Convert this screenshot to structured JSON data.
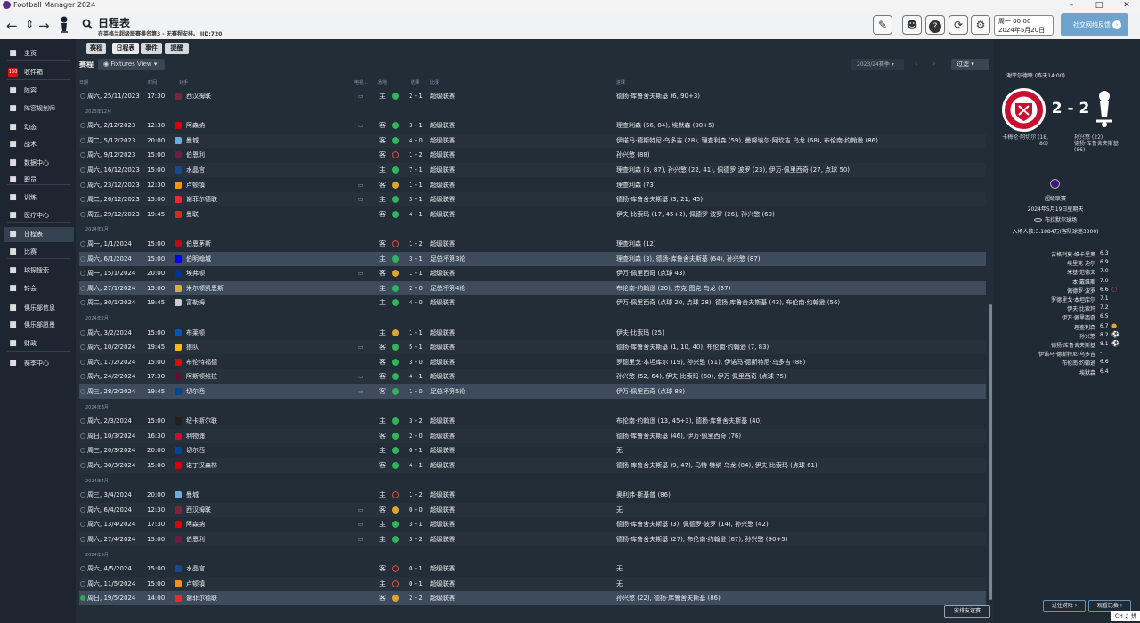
{
  "window": {
    "title": "Football Manager 2024"
  },
  "header": {
    "title": "日程表",
    "subtitle": "在英格兰超级联赛排名第3 - 无赛程安排。 IID:720",
    "date_line1": "周一 00:00",
    "date_line2": "2024年5月20日",
    "social_label": "社交网络反馈"
  },
  "tabs": [
    "赛程",
    "日程表",
    "事件",
    "提醒"
  ],
  "main": {
    "section_label": "赛程",
    "view_label": "Fixtures View",
    "season": "2023/24赛季",
    "filter_label": "过滤",
    "friendly_label": "安排友谊赛"
  },
  "columns": {
    "date": "日期",
    "time": "时间",
    "opponent": "对手",
    "tv": "电视...",
    "venue": "场地",
    "result": "结果",
    "competition": "比赛",
    "scorers": "进球"
  },
  "sidebar": [
    {
      "label": "主页",
      "icon": "home-icon"
    },
    {
      "label": "收件箱",
      "icon": "inbox-icon",
      "badge": "150"
    },
    {
      "label": "阵容",
      "icon": "shirt-icon"
    },
    {
      "label": "阵容规划师",
      "icon": "planner-icon"
    },
    {
      "label": "动态",
      "icon": "dynamics-icon"
    },
    {
      "label": "战术",
      "icon": "tactics-icon"
    },
    {
      "label": "数据中心",
      "icon": "data-icon"
    },
    {
      "label": "职员",
      "icon": "staff-icon"
    },
    {
      "label": "训练",
      "icon": "training-icon"
    },
    {
      "label": "医疗中心",
      "icon": "medical-icon"
    },
    {
      "label": "日程表",
      "icon": "calendar-icon"
    },
    {
      "label": "比赛",
      "icon": "trophy-icon"
    },
    {
      "label": "球探搜索",
      "icon": "scout-icon"
    },
    {
      "label": "转会",
      "icon": "transfer-icon"
    },
    {
      "label": "俱乐部信息",
      "icon": "club-icon"
    },
    {
      "label": "俱乐部愿景",
      "icon": "vision-icon"
    },
    {
      "label": "财政",
      "icon": "finance-icon"
    },
    {
      "label": "赛季中心",
      "icon": "season-icon"
    }
  ],
  "fixtures": [
    {
      "date": "周六, 25/11/2023",
      "time": "17:30",
      "opp": "西汉姆联",
      "crest": "#7a263a",
      "tv": true,
      "venue": "主",
      "res": "W",
      "score": "2 - 1",
      "comp": "超级联赛",
      "scorers": "德扬·库鲁舍夫斯基 (6, 90+3)"
    },
    {
      "month": "2023年12月"
    },
    {
      "date": "周六, 2/12/2023",
      "time": "12:30",
      "opp": "阿森纳",
      "crest": "#db0007",
      "tv": true,
      "venue": "客",
      "res": "W",
      "score": "3 - 1",
      "comp": "超级联赛",
      "scorers": "理查利森 (56, 84), 埃默森 (90+5)"
    },
    {
      "date": "周二, 5/12/2023",
      "time": "20:00",
      "opp": "曼城",
      "crest": "#6cabdd",
      "tv": false,
      "venue": "客",
      "res": "W",
      "score": "4 - 0",
      "comp": "超级联赛",
      "scorers": "伊诺马·德斯特尼·乌多吉 (28), 理查利森 (59), 曼努埃尔·阿坎吉 乌龙 (68), 布伦南·约翰逊 (86)"
    },
    {
      "date": "周六, 9/12/2023",
      "time": "15:00",
      "opp": "伯恩利",
      "crest": "#6c1d45",
      "tv": false,
      "venue": "客",
      "res": "L",
      "score": "1 - 2",
      "comp": "超级联赛",
      "scorers": "孙兴慜 (88)"
    },
    {
      "date": "周六, 16/12/2023",
      "time": "15:00",
      "opp": "水晶宫",
      "crest": "#1b458f",
      "tv": false,
      "venue": "主",
      "res": "W",
      "score": "7 - 1",
      "comp": "超级联赛",
      "scorers": "理查利森 (3, 87), 孙兴慜 (22, 41), 佩德罗·波罗 (23), 伊万·佩里西奇 (27, 点球 50)"
    },
    {
      "date": "周六, 23/12/2023",
      "time": "12:30",
      "opp": "卢顿镇",
      "crest": "#f78f1e",
      "tv": true,
      "venue": "客",
      "res": "D",
      "score": "1 - 1",
      "comp": "超级联赛",
      "scorers": "理查利森 (73)"
    },
    {
      "date": "周二, 26/12/2023",
      "time": "15:00",
      "opp": "谢菲尔德联",
      "crest": "#ee2737",
      "tv": true,
      "venue": "主",
      "res": "W",
      "score": "3 - 1",
      "comp": "超级联赛",
      "scorers": "德扬·库鲁舍夫斯基 (3, 21, 45)"
    },
    {
      "date": "周五, 29/12/2023",
      "time": "19:45",
      "opp": "曼联",
      "crest": "#da291c",
      "tv": false,
      "venue": "客",
      "res": "W",
      "score": "4 - 1",
      "comp": "超级联赛",
      "scorers": "伊夫·比索玛 (17, 45+2), 佩德罗·波罗 (26), 孙兴慜 (60)"
    },
    {
      "month": "2024年1月"
    },
    {
      "date": "周一, 1/1/2024",
      "time": "15:00",
      "opp": "伯恩茅斯",
      "crest": "#b50e12",
      "tv": false,
      "venue": "客",
      "res": "L",
      "score": "1 - 2",
      "comp": "超级联赛",
      "scorers": "理查利森 (12)"
    },
    {
      "date": "周六, 6/1/2024",
      "time": "15:00",
      "opp": "伯明翰城",
      "crest": "#0000ff",
      "tv": false,
      "venue": "主",
      "res": "W",
      "score": "3 - 1",
      "comp": "足总杯第3轮",
      "scorers": "理查利森 (3), 德扬·库鲁舍夫斯基 (64), 孙兴慜 (87)",
      "hl": true
    },
    {
      "date": "周一, 15/1/2024",
      "time": "20:00",
      "opp": "埃弗顿",
      "crest": "#003399",
      "tv": true,
      "venue": "客",
      "res": "D",
      "score": "1 - 1",
      "comp": "超级联赛",
      "scorers": "伊万·佩里西奇 (点球 43)"
    },
    {
      "date": "周六, 27/1/2024",
      "time": "15:00",
      "opp": "米尔顿凯恩斯",
      "crest": "#d4af37",
      "tv": false,
      "venue": "主",
      "res": "W",
      "score": "2 - 0",
      "comp": "足总杯第4轮",
      "scorers": "布伦南·约翰逊 (20), 杰克·图克 乌龙 (37)",
      "hl": true
    },
    {
      "date": "周二, 30/1/2024",
      "time": "19:45",
      "opp": "富勒姆",
      "crest": "#cccccc",
      "tv": false,
      "venue": "主",
      "res": "W",
      "score": "4 - 0",
      "comp": "超级联赛",
      "scorers": "伊万·佩里西奇 (点球 20, 点球 28), 德扬·库鲁舍夫斯基 (43), 布伦南·约翰逊 (56)"
    },
    {
      "month": "2024年2月"
    },
    {
      "date": "周六, 3/2/2024",
      "time": "15:00",
      "opp": "布莱顿",
      "crest": "#0057b8",
      "tv": false,
      "venue": "主",
      "res": "D",
      "score": "1 - 1",
      "comp": "超级联赛",
      "scorers": "伊夫·比索玛 (25)"
    },
    {
      "date": "周六, 10/2/2024",
      "time": "19:45",
      "opp": "狼队",
      "crest": "#fdb913",
      "tv": true,
      "venue": "客",
      "res": "W",
      "score": "5 - 1",
      "comp": "超级联赛",
      "scorers": "德扬·库鲁舍夫斯基 (1, 10, 40), 布伦南·约翰逊 (7, 83)"
    },
    {
      "date": "周六, 17/2/2024",
      "time": "15:00",
      "opp": "布伦特福德",
      "crest": "#e30613",
      "tv": false,
      "venue": "客",
      "res": "W",
      "score": "3 - 0",
      "comp": "超级联赛",
      "scorers": "罗德里戈·本坦库尔 (19), 孙兴慜 (51), 伊诺马·德斯特尼·乌多吉 (88)"
    },
    {
      "date": "周六, 24/2/2024",
      "time": "17:30",
      "opp": "阿斯顿维拉",
      "crest": "#670e36",
      "tv": true,
      "venue": "客",
      "res": "W",
      "score": "4 - 1",
      "comp": "超级联赛",
      "scorers": "孙兴慜 (52, 64), 伊夫·比索玛 (60), 伊万·佩里西奇 (点球 75)"
    },
    {
      "date": "周三, 28/2/2024",
      "time": "19:45",
      "opp": "切尔西",
      "crest": "#034694",
      "tv": true,
      "venue": "客",
      "res": "W",
      "score": "1 - 0",
      "comp": "足总杯第5轮",
      "scorers": "伊万·佩里西奇 (点球 88)",
      "hl": true
    },
    {
      "month": "2024年3月"
    },
    {
      "date": "周六, 2/3/2024",
      "time": "15:00",
      "opp": "纽卡斯尔联",
      "crest": "#241f20",
      "tv": false,
      "venue": "主",
      "res": "W",
      "score": "3 - 2",
      "comp": "超级联赛",
      "scorers": "布伦南·约翰逊 (13, 45+3), 德扬·库鲁舍夫斯基 (40)"
    },
    {
      "date": "周日, 10/3/2024",
      "time": "16:30",
      "opp": "利物浦",
      "crest": "#c8102e",
      "tv": false,
      "venue": "客",
      "res": "W",
      "score": "2 - 0",
      "comp": "超级联赛",
      "scorers": "德扬·库鲁舍夫斯基 (46), 伊万·佩里西奇 (76)"
    },
    {
      "date": "周三, 20/3/2024",
      "time": "20:00",
      "opp": "切尔西",
      "crest": "#034694",
      "tv": false,
      "venue": "主",
      "res": "W",
      "score": "0 - 1",
      "comp": "超级联赛",
      "scorers": "无"
    },
    {
      "date": "周六, 30/3/2024",
      "time": "15:00",
      "opp": "诺丁汉森林",
      "crest": "#dd0000",
      "tv": false,
      "venue": "客",
      "res": "W",
      "score": "4 - 1",
      "comp": "超级联赛",
      "scorers": "德扬·库鲁舍夫斯基 (9, 47), 马特·特纳 乌龙 (84), 伊夫·比索玛 (点球 61)"
    },
    {
      "month": "2024年4月"
    },
    {
      "date": "周三, 3/4/2024",
      "time": "20:00",
      "opp": "曼城",
      "crest": "#6cabdd",
      "tv": false,
      "venue": "主",
      "res": "L",
      "score": "1 - 2",
      "comp": "超级联赛",
      "scorers": "奥利弗·斯基普 (86)"
    },
    {
      "date": "周六, 6/4/2024",
      "time": "12:30",
      "opp": "西汉姆联",
      "crest": "#7a263a",
      "tv": true,
      "venue": "客",
      "res": "D",
      "score": "0 - 0",
      "comp": "超级联赛",
      "scorers": "无"
    },
    {
      "date": "周六, 13/4/2024",
      "time": "17:30",
      "opp": "阿森纳",
      "crest": "#db0007",
      "tv": true,
      "venue": "主",
      "res": "W",
      "score": "3 - 1",
      "comp": "超级联赛",
      "scorers": "德扬·库鲁舍夫斯基 (3), 佩德罗·波罗 (14), 孙兴慜 (42)"
    },
    {
      "date": "周六, 27/4/2024",
      "time": "15:00",
      "opp": "伯恩利",
      "crest": "#6c1d45",
      "tv": true,
      "venue": "主",
      "res": "W",
      "score": "3 - 2",
      "comp": "超级联赛",
      "scorers": "德扬·库鲁舍夫斯基 (27), 布伦南·约翰逊 (67), 孙兴慜 (90+5)"
    },
    {
      "month": "2024年5月"
    },
    {
      "date": "周六, 4/5/2024",
      "time": "15:00",
      "opp": "水晶宫",
      "crest": "#1b458f",
      "tv": false,
      "venue": "客",
      "res": "L",
      "score": "0 - 1",
      "comp": "超级联赛",
      "scorers": "无"
    },
    {
      "date": "周六, 11/5/2024",
      "time": "15:00",
      "opp": "卢顿镇",
      "crest": "#f78f1e",
      "tv": false,
      "venue": "主",
      "res": "L",
      "score": "0 - 1",
      "comp": "超级联赛",
      "scorers": "无"
    },
    {
      "date": "周日, 19/5/2024",
      "time": "14:00",
      "opp": "谢菲尔德联",
      "crest": "#ee2737",
      "tv": false,
      "venue": "客",
      "res": "D",
      "score": "2 - 2",
      "comp": "超级联赛",
      "scorers": "孙兴慜 (22), 德扬·库鲁舍夫斯基 (86)",
      "hl": true,
      "last": true
    }
  ],
  "match": {
    "header": "谢菲尔德联 (昨天14:00)",
    "score": "2 - 2",
    "home_scorers": [
      "卡梅伦·阿切尔 (18,",
      "80)"
    ],
    "away_scorers": [
      "孙兴慜 (22)",
      "德扬·库鲁舍夫斯基",
      "(86)"
    ],
    "competition": "超级联赛",
    "date": "2024年5月19日星期天",
    "stadium": "布拉默尔球场",
    "attendance": "入场人数:3.1884万(客队球迷3000)",
    "ratings": [
      {
        "name": "古格列莫·维卡里奥",
        "rating": "6.3"
      },
      {
        "name": "埃里克·迪尔",
        "rating": "6.9"
      },
      {
        "name": "米基·范德文",
        "rating": "7.0"
      },
      {
        "name": "本·戴维斯",
        "rating": "7.0"
      },
      {
        "name": "佩德罗·波罗",
        "rating": "6.6",
        "icon": "○",
        "color": "#e24a3a"
      },
      {
        "name": "罗德里戈·本坦库尔",
        "rating": "7.1"
      },
      {
        "name": "伊夫·比索玛",
        "rating": "7.2"
      },
      {
        "name": "伊万·佩里西奇",
        "rating": "6.5"
      },
      {
        "name": "理查利森",
        "rating": "6.7",
        "icon": "●",
        "color": "#e0a52b"
      },
      {
        "name": "孙兴慜",
        "rating": "8.2",
        "icon": "⚽",
        "color": "#ffffff"
      },
      {
        "name": "德扬·库鲁舍夫斯基",
        "rating": "8.1",
        "icon": "⚽",
        "color": "#ffffff"
      },
      {
        "name": "伊诺马·德斯特尼·乌多吉",
        "rating": "-"
      },
      {
        "name": "布伦南·约翰逊",
        "rating": "6.6"
      },
      {
        "name": "埃默森",
        "rating": "6.4"
      }
    ],
    "btn_back": "过往对阵",
    "btn_view": "观看比赛"
  },
  "ime": "CH ♫ 拼"
}
